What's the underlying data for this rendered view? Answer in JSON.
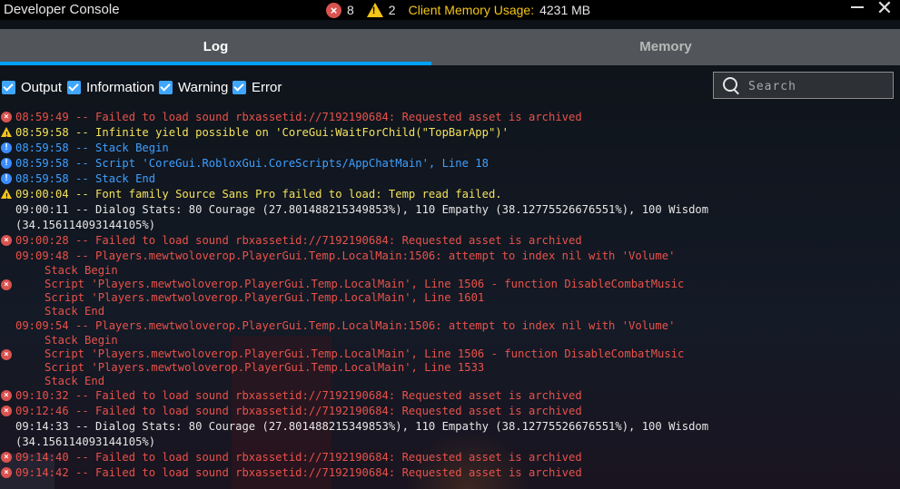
{
  "window": {
    "title": "Developer Console",
    "error_count": "8",
    "warning_count": "2",
    "memory_label": "Client Memory Usage:",
    "memory_value": "4231 MB"
  },
  "tabs": [
    {
      "label": "Log",
      "active": true
    },
    {
      "label": "Memory",
      "active": false
    }
  ],
  "filters": [
    {
      "label": "Output",
      "checked": true
    },
    {
      "label": "Information",
      "checked": true
    },
    {
      "label": "Warning",
      "checked": true
    },
    {
      "label": "Error",
      "checked": true
    }
  ],
  "search": {
    "placeholder": "Search",
    "value": ""
  },
  "colors": {
    "accent": "#00a2ff",
    "error": "#e8524a",
    "warning": "#f3e25b",
    "info": "#3f9fff",
    "output": "#e6e6e6"
  },
  "log": [
    {
      "type": "error",
      "text": "08:59:49 -- Failed to load sound rbxassetid://7192190684: Requested asset is archived"
    },
    {
      "type": "warning",
      "text": "08:59:58 -- Infinite yield possible on 'CoreGui:WaitForChild(\"TopBarApp\")'"
    },
    {
      "type": "info",
      "text": "08:59:58 -- Stack Begin"
    },
    {
      "type": "info",
      "text": "08:59:58 -- Script 'CoreGui.RobloxGui.CoreScripts/AppChatMain', Line 18"
    },
    {
      "type": "info",
      "text": "08:59:58 -- Stack End"
    },
    {
      "type": "warning",
      "text": "09:00:04 -- Font family Source Sans Pro failed to load: Temp read failed."
    },
    {
      "type": "output",
      "text": "09:00:11 -- Dialog Stats: 80 Courage (27.801488215349853%), 110 Empathy (38.12775526676551%), 100 Wisdom",
      "text2": "(34.156114093144105%)"
    },
    {
      "type": "error",
      "text": "09:00:28 -- Failed to load sound rbxassetid://7192190684: Requested asset is archived"
    },
    {
      "type": "error",
      "text": "09:09:48 -- Players.mewtwoloverop.PlayerGui.Temp.LocalMain:1506: attempt to index nil with 'Volume'",
      "stack": [
        "Stack Begin",
        "Script 'Players.mewtwoloverop.PlayerGui.Temp.LocalMain', Line 1506 - function DisableCombatMusic",
        "Script 'Players.mewtwoloverop.PlayerGui.Temp.LocalMain', Line 1601",
        "Stack End"
      ]
    },
    {
      "type": "error",
      "text": "09:09:54 -- Players.mewtwoloverop.PlayerGui.Temp.LocalMain:1506: attempt to index nil with 'Volume'",
      "stack": [
        "Stack Begin",
        "Script 'Players.mewtwoloverop.PlayerGui.Temp.LocalMain', Line 1506 - function DisableCombatMusic",
        "Script 'Players.mewtwoloverop.PlayerGui.Temp.LocalMain', Line 1533",
        "Stack End"
      ]
    },
    {
      "type": "error",
      "text": "09:10:32 -- Failed to load sound rbxassetid://7192190684: Requested asset is archived"
    },
    {
      "type": "error",
      "text": "09:12:46 -- Failed to load sound rbxassetid://7192190684: Requested asset is archived"
    },
    {
      "type": "output",
      "text": "09:14:33 -- Dialog Stats: 80 Courage (27.801488215349853%), 110 Empathy (38.12775526676551%), 100 Wisdom",
      "text2": "(34.156114093144105%)"
    },
    {
      "type": "error",
      "text": "09:14:40 -- Failed to load sound rbxassetid://7192190684: Requested asset is archived"
    },
    {
      "type": "error",
      "text": "09:14:42 -- Failed to load sound rbxassetid://7192190684: Requested asset is archived"
    }
  ]
}
